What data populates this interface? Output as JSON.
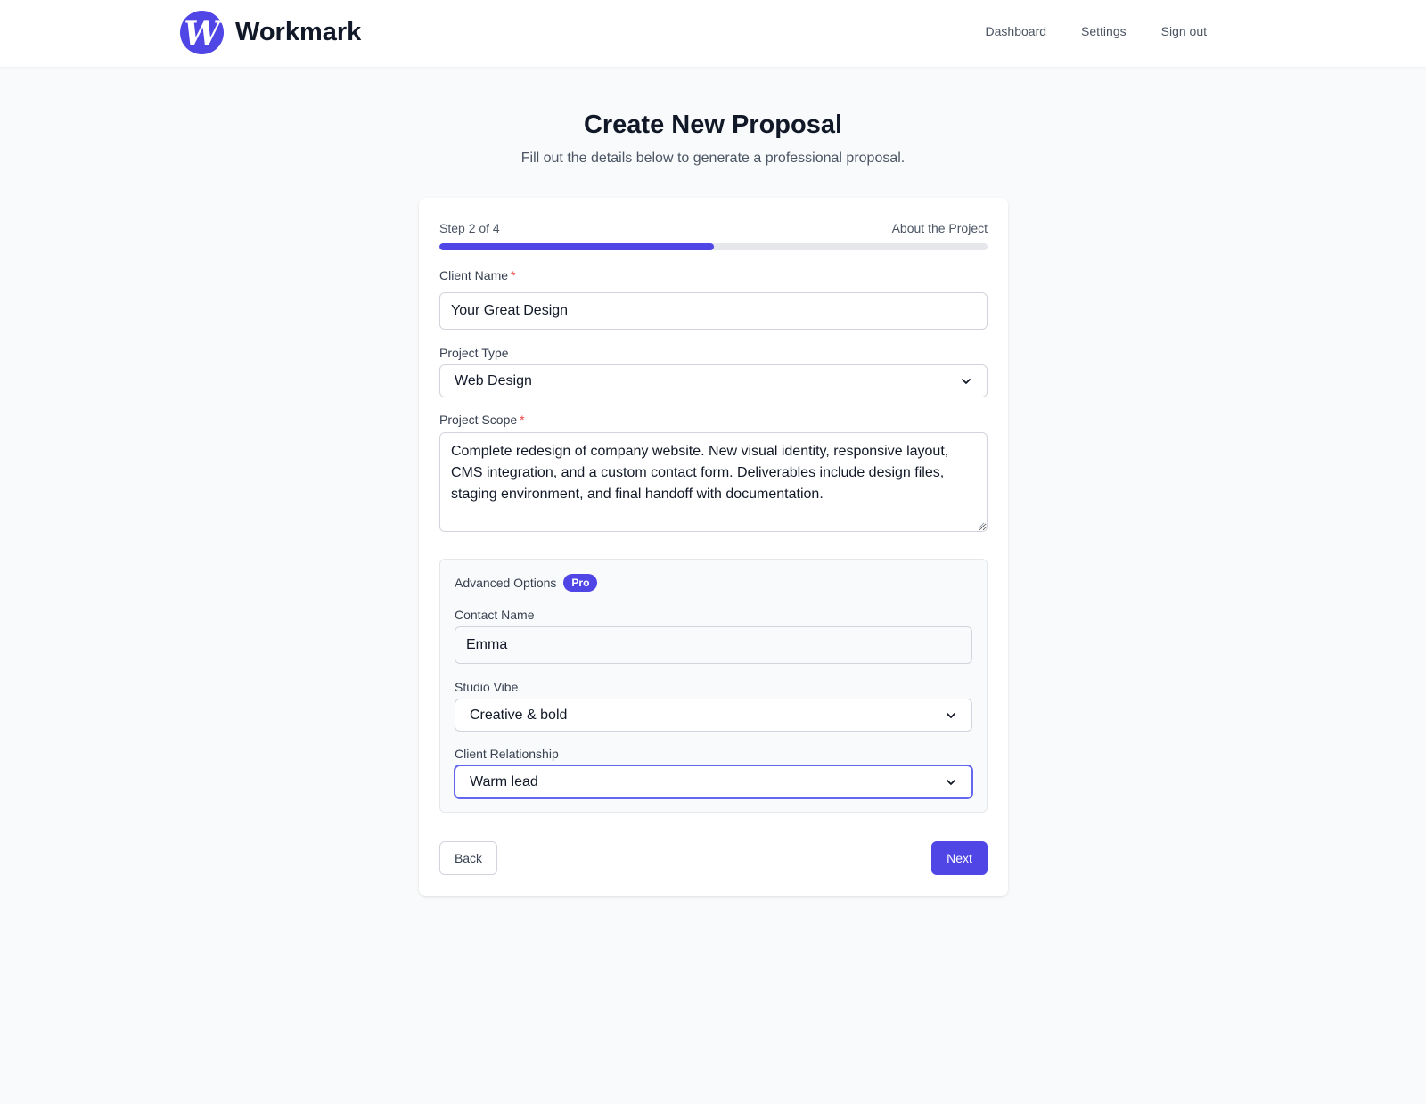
{
  "app": {
    "logo_letter": "W",
    "brand_name": "Workmark",
    "brand_color": "#4f46e5"
  },
  "nav": {
    "items": [
      "Dashboard",
      "Settings",
      "Sign out"
    ]
  },
  "page": {
    "title": "Create New Proposal",
    "subtitle": "Fill out the details below to generate a professional proposal."
  },
  "wizard": {
    "step_label": "Step 2 of 4",
    "section_label": "About the Project",
    "progress_fraction": 0.5
  },
  "form": {
    "client_name": {
      "label": "Client Name",
      "required_mark": "*",
      "value": "Your Great Design"
    },
    "project_type": {
      "label": "Project Type",
      "selected": "Web Design"
    },
    "project_scope": {
      "label": "Project Scope",
      "required_mark": "*",
      "value": "Complete redesign of company website. New visual identity, responsive layout, CMS integration, and a custom contact form. Deliverables include design files, staging environment, and final handoff with documentation."
    }
  },
  "advanced": {
    "title": "Advanced Options",
    "badge": "Pro",
    "contact_name": {
      "label": "Contact Name",
      "value": "Emma"
    },
    "studio_vibe": {
      "label": "Studio Vibe",
      "selected": "Creative & bold"
    },
    "client_relationship": {
      "label": "Client Relationship",
      "selected": "Warm lead"
    }
  },
  "actions": {
    "back_label": "Back",
    "next_label": "Next"
  }
}
